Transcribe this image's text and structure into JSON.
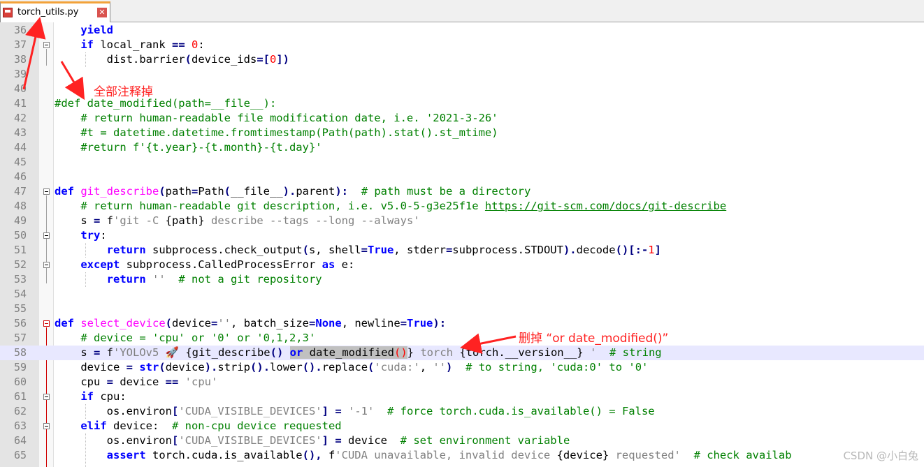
{
  "tab": {
    "filename": "torch_utils.py",
    "close_glyph": "✕",
    "icon": "floppy-disk-icon"
  },
  "annotations": {
    "comment_out": "全部注释掉",
    "delete_hint": "删掉 “or date_modified()”"
  },
  "watermark": "CSDN @小白兔",
  "colors": {
    "keyword": "#0000ff",
    "comment": "#008000",
    "string": "#808080",
    "number": "#ff0000",
    "function": "#ff00ff",
    "annotation": "#ff2222"
  },
  "lines": [
    {
      "n": "36",
      "t": "    yield"
    },
    {
      "n": "37",
      "t": "    if local_rank == 0:"
    },
    {
      "n": "38",
      "t": "        dist.barrier(device_ids=[0])"
    },
    {
      "n": "39",
      "t": ""
    },
    {
      "n": "40",
      "t": ""
    },
    {
      "n": "41",
      "t": "#def date_modified(path=__file__):"
    },
    {
      "n": "42",
      "t": "    # return human-readable file modification date, i.e. '2021-3-26'"
    },
    {
      "n": "43",
      "t": "    #t = datetime.datetime.fromtimestamp(Path(path).stat().st_mtime)"
    },
    {
      "n": "44",
      "t": "    #return f'{t.year}-{t.month}-{t.day}'"
    },
    {
      "n": "45",
      "t": ""
    },
    {
      "n": "46",
      "t": ""
    },
    {
      "n": "47",
      "t": "def git_describe(path=Path(__file__).parent):  # path must be a directory"
    },
    {
      "n": "48",
      "t": "    # return human-readable git description, i.e. v5.0-5-g3e25f1e https://git-scm.com/docs/git-describe"
    },
    {
      "n": "49",
      "t": "    s = f'git -C {path} describe --tags --long --always'"
    },
    {
      "n": "50",
      "t": "    try:"
    },
    {
      "n": "51",
      "t": "        return subprocess.check_output(s, shell=True, stderr=subprocess.STDOUT).decode()[:-1]"
    },
    {
      "n": "52",
      "t": "    except subprocess.CalledProcessError as e:"
    },
    {
      "n": "53",
      "t": "        return ''  # not a git repository"
    },
    {
      "n": "54",
      "t": ""
    },
    {
      "n": "55",
      "t": ""
    },
    {
      "n": "56",
      "t": "def select_device(device='', batch_size=None, newline=True):"
    },
    {
      "n": "57",
      "t": "    # device = 'cpu' or '0' or '0,1,2,3'"
    },
    {
      "n": "58",
      "t": "    s = f'YOLOv5 🚀 {git_describe() or date_modified()} torch {torch.__version__} '  # string"
    },
    {
      "n": "59",
      "t": "    device = str(device).strip().lower().replace('cuda:', '')  # to string, 'cuda:0' to '0'"
    },
    {
      "n": "60",
      "t": "    cpu = device == 'cpu'"
    },
    {
      "n": "61",
      "t": "    if cpu:"
    },
    {
      "n": "62",
      "t": "        os.environ['CUDA_VISIBLE_DEVICES'] = '-1'  # force torch.cuda.is_available() = False"
    },
    {
      "n": "63",
      "t": "    elif device:  # non-cpu device requested"
    },
    {
      "n": "64",
      "t": "        os.environ['CUDA_VISIBLE_DEVICES'] = device  # set environment variable"
    },
    {
      "n": "65",
      "t": "        assert torch.cuda.is_available(), f'CUDA unavailable, invalid device {device} requested'  # check availab"
    }
  ]
}
